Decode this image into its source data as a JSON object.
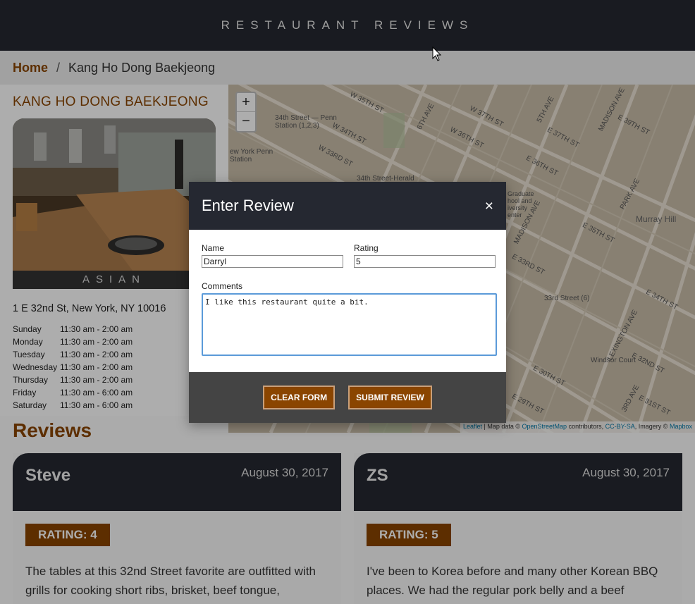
{
  "header": {
    "title": "RESTAURANT REVIEWS"
  },
  "breadcrumb": {
    "home": "Home",
    "separator": "/",
    "current": "Kang Ho Dong Baekjeong"
  },
  "restaurant": {
    "name": "KANG HO DONG BAEKJEONG",
    "cuisine": "ASIAN",
    "address": "1 E 32nd St, New York, NY 10016",
    "hours": [
      {
        "day": "Sunday",
        "time": "11:30 am - 2:00 am"
      },
      {
        "day": "Monday",
        "time": "11:30 am - 2:00 am"
      },
      {
        "day": "Tuesday",
        "time": "11:30 am - 2:00 am"
      },
      {
        "day": "Wednesday",
        "time": "11:30 am - 2:00 am"
      },
      {
        "day": "Thursday",
        "time": "11:30 am - 2:00 am"
      },
      {
        "day": "Friday",
        "time": "11:30 am - 6:00 am"
      },
      {
        "day": "Saturday",
        "time": "11:30 am - 6:00 am"
      }
    ]
  },
  "map": {
    "zoom_in": "+",
    "zoom_out": "−",
    "labels": {
      "w35": "W 35TH ST",
      "w34": "W 34TH ST",
      "w33": "W 33RD ST",
      "penn": "34th Street — Penn Station (1,2,3)",
      "nypenn": "ew York Penn Station",
      "herald": "34th Street-Herald",
      "w37": "W 37TH ST",
      "w36": "W 36TH ST",
      "fifth": "5TH AVE",
      "sixth": "6TH AVE",
      "madison": "MADISON AVE",
      "madison2": "MADISON AVE",
      "e39": "E 39TH ST",
      "e37": "E 37TH ST",
      "e36": "E 36TH ST",
      "e35": "E 35TH ST",
      "e34": "E 34TH ST",
      "e33": "E 33RD ST",
      "e30": "E 30TH ST",
      "e29": "E 29TH ST",
      "e31": "E 31ST ST",
      "e32": "E 32ND ST",
      "park": "PARK AVE",
      "lex": "LEXINGTON AVE",
      "third": "3RD AVE",
      "murray": "Murray Hill",
      "station33": "33rd Street (6)",
      "windsor": "Windsor Court",
      "graduate": "Graduate hool and iversity enter"
    },
    "attribution": {
      "leaflet": "Leaflet",
      "mapdata": "| Map data ©",
      "osm": "OpenStreetMap",
      "contrib": "contributors,",
      "ccbysa": "CC-BY-SA",
      "imagery": ", Imagery ©",
      "mapbox": "Mapbox"
    }
  },
  "reviews": {
    "title": "Reviews",
    "items": [
      {
        "name": "Steve",
        "date": "August 30, 2017",
        "rating": "RATING: 4",
        "text": "The tables at this 32nd Street favorite are outfitted with grills for cooking short ribs, brisket, beef tongue,"
      },
      {
        "name": "ZS",
        "date": "August 30, 2017",
        "rating": "RATING: 5",
        "text": "I've been to Korea before and many other Korean BBQ places. We had the regular pork belly and a beef"
      }
    ]
  },
  "modal": {
    "title": "Enter Review",
    "close": "×",
    "name_label": "Name",
    "name_value": "Darryl",
    "rating_label": "Rating",
    "rating_value": "5",
    "comments_label": "Comments",
    "comments_value": "I like this restaurant quite a bit.",
    "clear_label": "CLEAR FORM",
    "submit_label": "SUBMIT REVIEW"
  }
}
